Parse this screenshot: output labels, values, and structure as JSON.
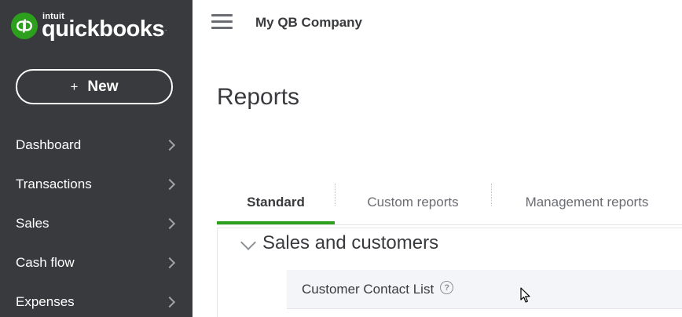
{
  "brand": {
    "intuit": "intuit",
    "name": "quickbooks",
    "reg": ".",
    "accent": "#2ca01c"
  },
  "sidebar": {
    "new_label": "New",
    "new_plus": "+",
    "items": [
      {
        "label": "Dashboard"
      },
      {
        "label": "Transactions"
      },
      {
        "label": "Sales"
      },
      {
        "label": "Cash flow"
      },
      {
        "label": "Expenses"
      }
    ]
  },
  "header": {
    "company": "My QB Company"
  },
  "page": {
    "title": "Reports"
  },
  "tabs": [
    {
      "label": "Standard",
      "active": true
    },
    {
      "label": "Custom reports",
      "active": false
    },
    {
      "label": "Management reports",
      "active": false
    }
  ],
  "section": {
    "title": "Sales and customers",
    "reports": [
      {
        "label": "Customer Contact List",
        "help": "?"
      }
    ]
  },
  "icons": {
    "logo": "qb-logo-icon",
    "menu": "hamburger-menu-icon",
    "chevron_right": "chevron-right-icon",
    "chevron_down": "chevron-down-icon",
    "help": "help-circle-icon",
    "cursor": "mouse-pointer-icon"
  }
}
